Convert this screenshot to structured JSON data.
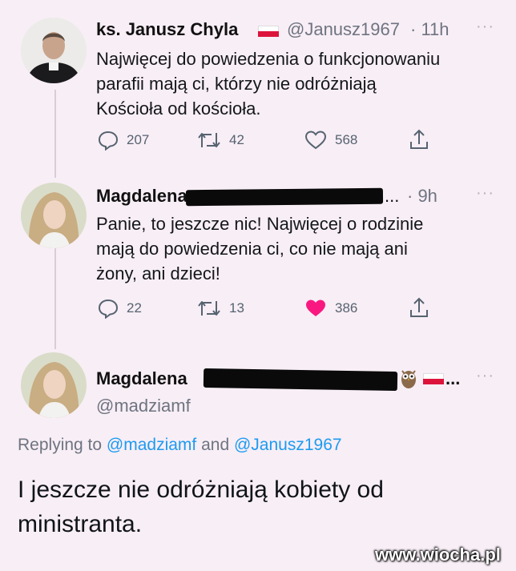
{
  "tweets": [
    {
      "name": "ks. Janusz Chyla",
      "handle": "@Janusz1967",
      "time": "· 11h",
      "text_lines": [
        "Najwięcej do powiedzenia o funkcjonowaniu",
        "parafii mają ci, którzy nie odróżniają",
        "Kościoła od kościoła."
      ],
      "replies": "207",
      "retweets": "42",
      "likes": "568",
      "liked": false
    },
    {
      "name": "Magdalena",
      "handle_suffix": "...",
      "time": "· 9h",
      "text_lines": [
        "Panie, to jeszcze nic! Najwięcej o rodzinie",
        "mają do powiedzenia ci, co nie mają ani",
        "żony, ani dzieci!"
      ],
      "replies": "22",
      "retweets": "13",
      "likes": "386",
      "liked": true
    }
  ],
  "main_tweet": {
    "name": "Magdalena",
    "name_suffix": "...",
    "handle": "@madziamf",
    "replying_prefix": "Replying to",
    "replying_mention_1": "@madziamf",
    "replying_and": "and",
    "replying_mention_2": "@Janusz1967",
    "text_lines": [
      "I jeszcze nie odróżniają kobiety od",
      "ministranta."
    ]
  },
  "more_label": "···",
  "watermark": "www.wiocha.pl",
  "colors": {
    "background": "#f8eef6",
    "like_active": "#f91880",
    "mention": "#1d9bf0",
    "secondary_text": "#6e7480"
  },
  "icons": [
    "reply-icon",
    "retweet-icon",
    "like-icon",
    "share-icon",
    "more-icon",
    "poland-flag-icon",
    "owl-emoji-icon"
  ]
}
